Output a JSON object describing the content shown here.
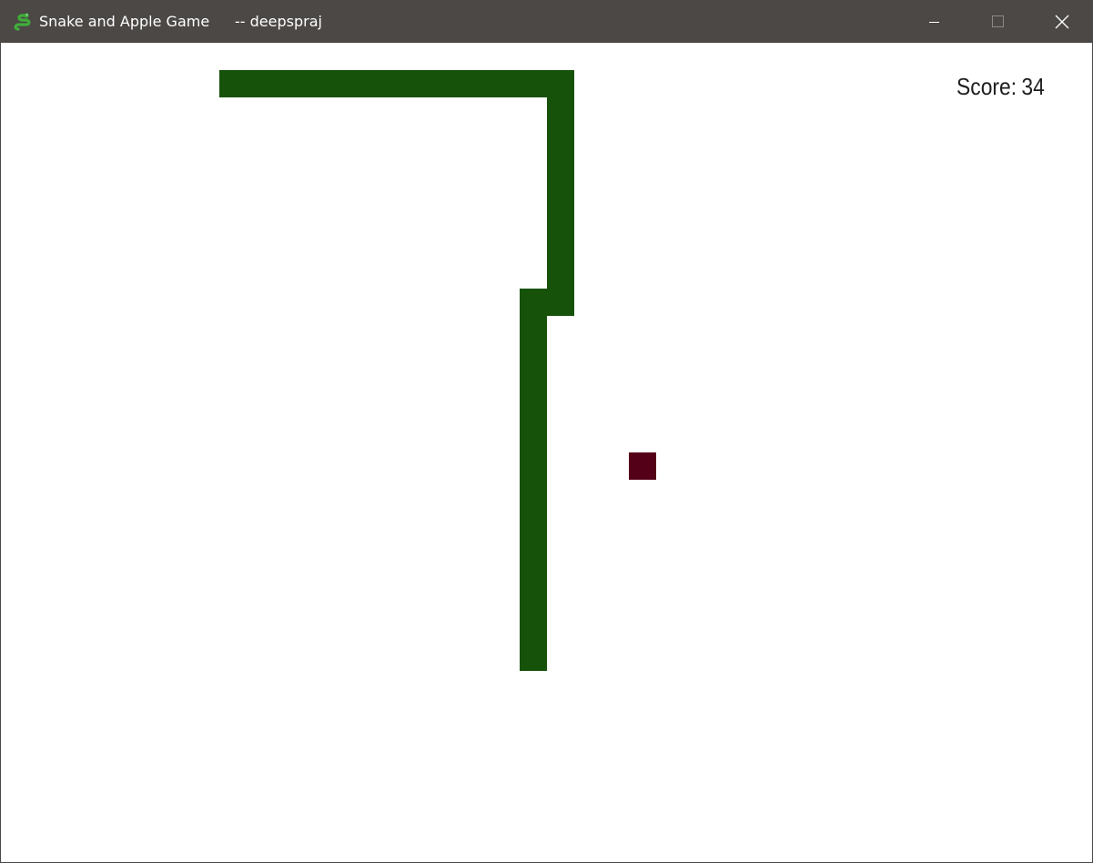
{
  "window": {
    "title": "Snake and Apple Game",
    "user": "-- deepspraj",
    "app_icon": "snake-icon",
    "controls": [
      "minimize-icon",
      "maximize-icon",
      "close-icon"
    ]
  },
  "game": {
    "score_label": "Score:",
    "score": "34",
    "colors": {
      "snake": "#17520a",
      "apple": "#550019",
      "background": "#ffffff"
    },
    "snake_length_blocks": 35,
    "apple_count": 1
  }
}
